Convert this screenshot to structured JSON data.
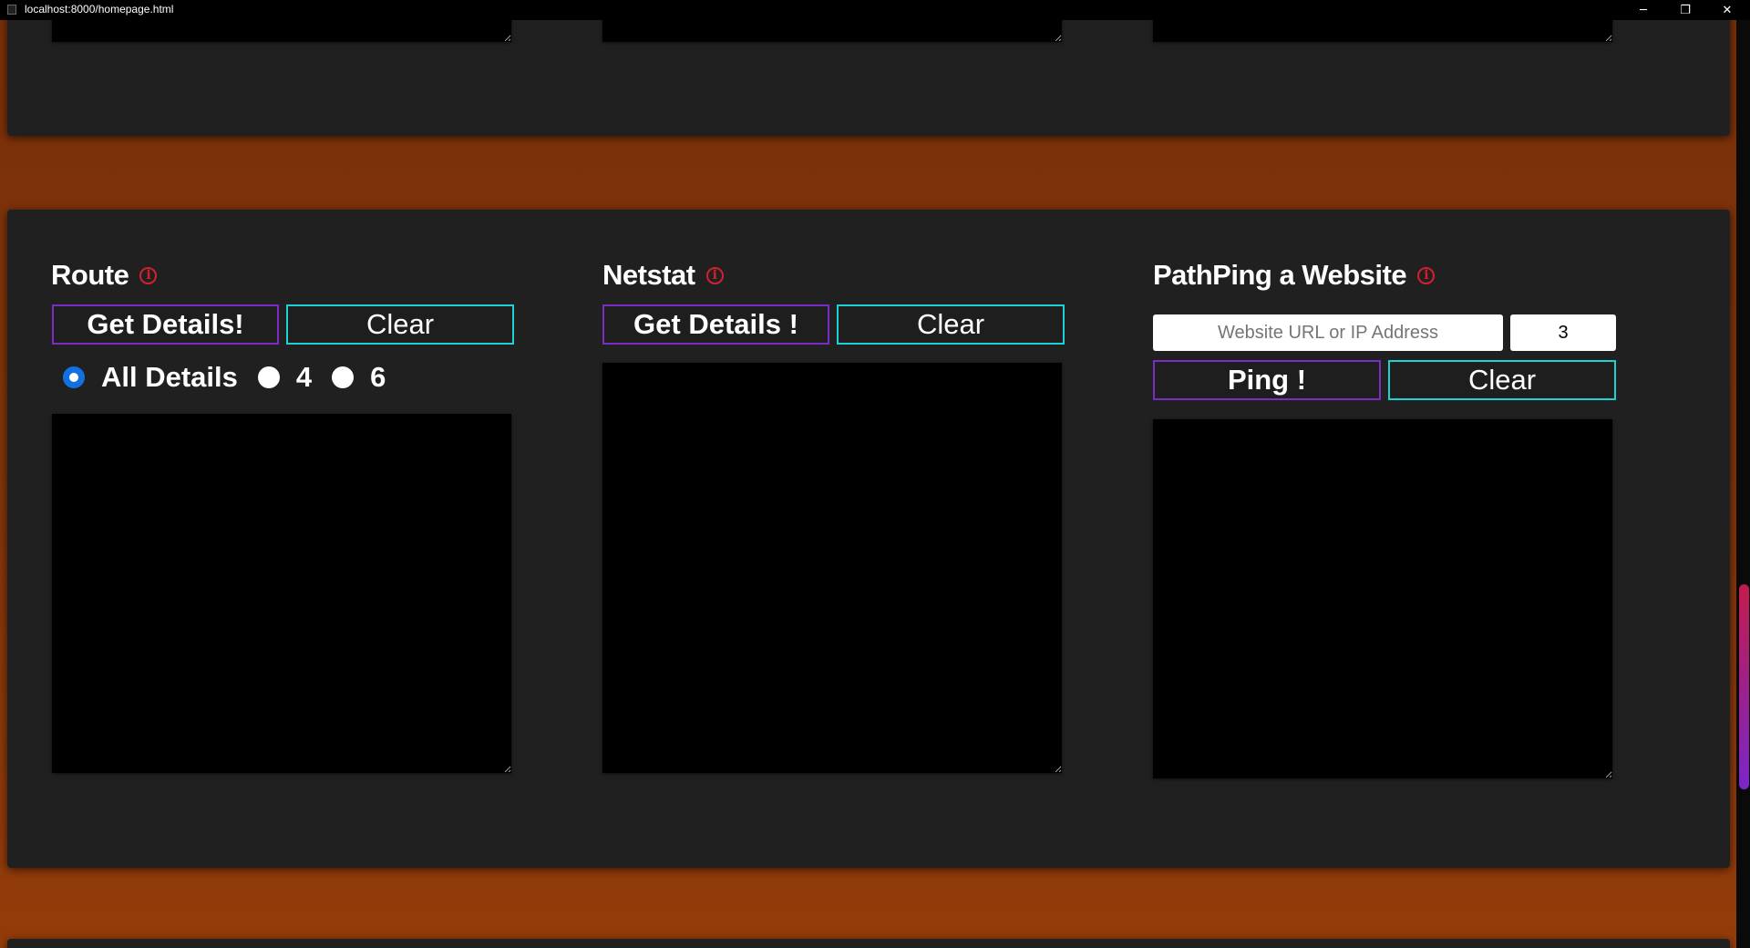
{
  "window": {
    "title": "localhost:8000/homepage.html",
    "controls": {
      "minimize": "─",
      "restore": "❐",
      "close": "✕"
    }
  },
  "route": {
    "title": "Route",
    "info_icon": "info-icon",
    "get_button": "Get Details!",
    "clear_button": "Clear",
    "radios": [
      {
        "label": "All Details",
        "checked": true
      },
      {
        "label": "4",
        "checked": false
      },
      {
        "label": "6",
        "checked": false
      }
    ]
  },
  "netstat": {
    "title": "Netstat",
    "info_icon": "info-icon",
    "get_button": "Get Details !",
    "clear_button": "Clear"
  },
  "pathping": {
    "title": "PathPing a Website",
    "info_icon": "info-icon",
    "url_placeholder": "Website URL or IP Address",
    "count_value": "3",
    "ping_button": "Ping !",
    "clear_button": "Clear"
  },
  "colors": {
    "accent_purple": "#7b2cc4",
    "accent_cyan": "#1ed1d6",
    "info_red": "#d3202f",
    "page_orange": "#82350a"
  }
}
